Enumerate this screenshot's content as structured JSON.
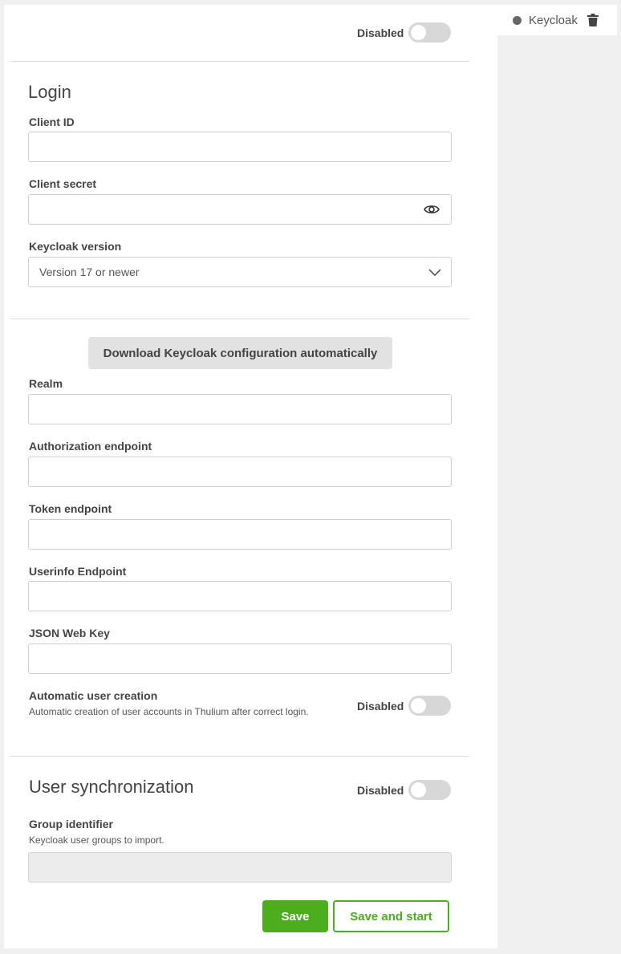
{
  "side_tab": {
    "label": "Keycloak"
  },
  "header": {
    "status_toggle_label": "Disabled",
    "status_enabled": false
  },
  "login": {
    "title": "Login",
    "client_id": {
      "label": "Client ID",
      "value": ""
    },
    "client_secret": {
      "label": "Client secret",
      "value": ""
    },
    "keycloak_version": {
      "label": "Keycloak version",
      "selected": "Version 17 or newer"
    }
  },
  "configuration": {
    "download_button": "Download Keycloak configuration automatically",
    "realm": {
      "label": "Realm",
      "value": ""
    },
    "authorization_endpoint": {
      "label": "Authorization endpoint",
      "value": ""
    },
    "token_endpoint": {
      "label": "Token endpoint",
      "value": ""
    },
    "userinfo_endpoint": {
      "label": "Userinfo Endpoint",
      "value": ""
    },
    "json_web_key": {
      "label": "JSON Web Key",
      "value": ""
    },
    "auto_user_creation": {
      "label": "Automatic user creation",
      "help": "Automatic creation of user accounts in Thulium after correct login.",
      "toggle_label": "Disabled",
      "enabled": false
    }
  },
  "user_sync": {
    "title": "User synchronization",
    "toggle_label": "Disabled",
    "enabled": false,
    "group_identifier": {
      "label": "Group identifier",
      "help": "Keycloak user groups to import.",
      "value": ""
    }
  },
  "actions": {
    "save": "Save",
    "save_and_start": "Save and start"
  },
  "icons": {
    "side_tab_status": "status-dot-icon",
    "delete": "trash-icon",
    "reveal": "eye-icon",
    "select": "chevron-down-icon"
  },
  "colors": {
    "accent": "#4cae1c",
    "toggle_off": "#d7d7d7"
  }
}
